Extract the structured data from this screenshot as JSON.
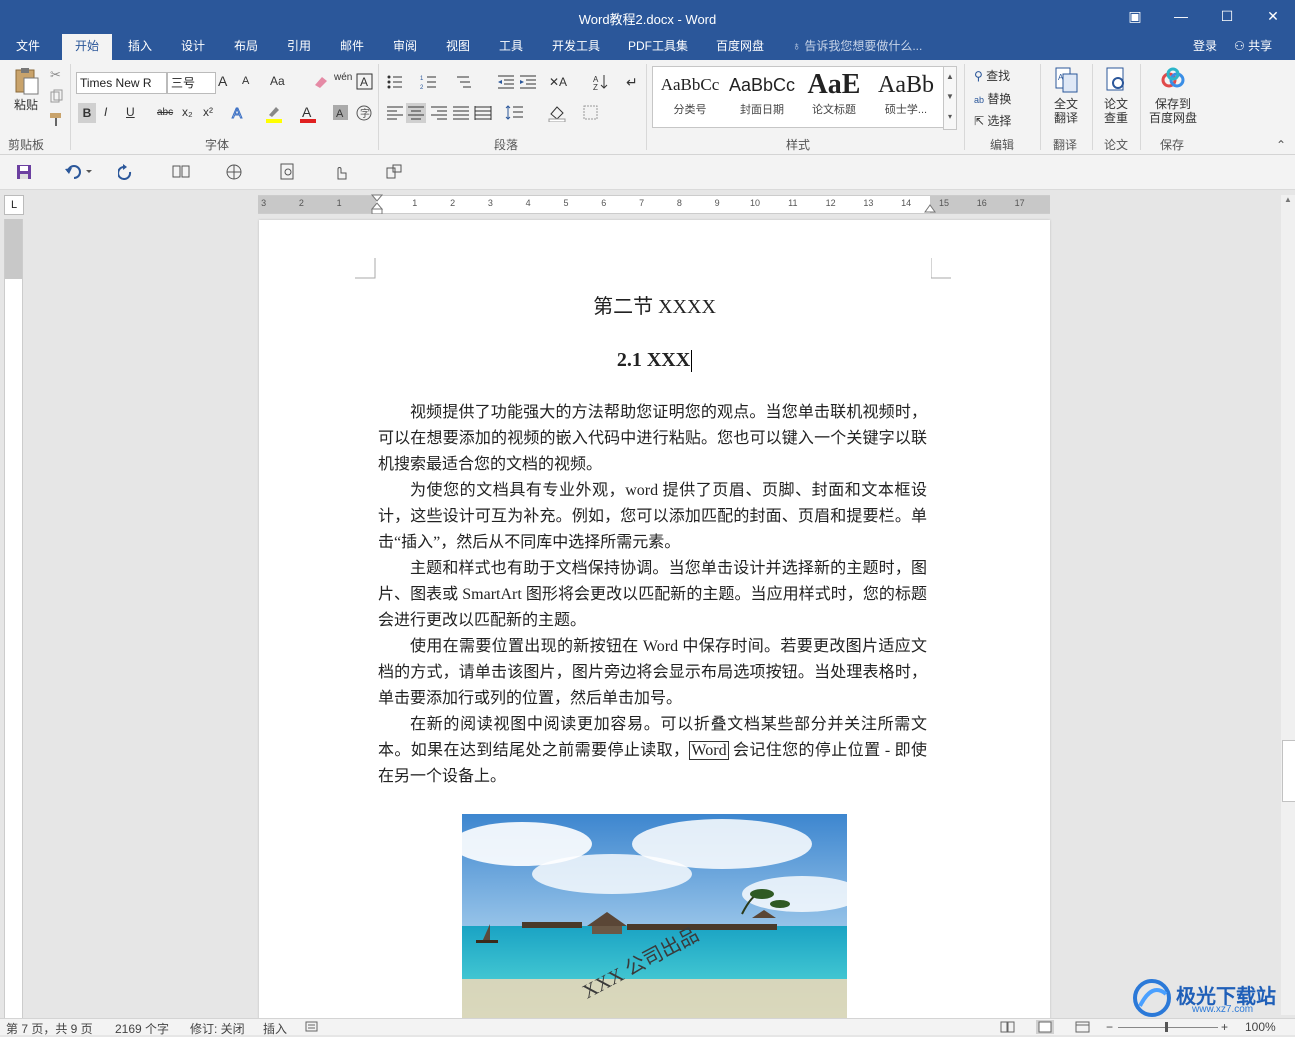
{
  "window": {
    "title": "Word教程2.docx - Word",
    "buttons": {
      "ribbon_options": "▣",
      "minimize": "—",
      "maximize": "☐",
      "close": "✕"
    }
  },
  "tabs": [
    "文件",
    "开始",
    "插入",
    "设计",
    "布局",
    "引用",
    "邮件",
    "审阅",
    "视图",
    "工具",
    "开发工具",
    "PDF工具集",
    "百度网盘"
  ],
  "active_tab": "开始",
  "tell_me": "告诉我您想要做什么...",
  "login": "登录",
  "share": "共享",
  "ribbon": {
    "clipboard": {
      "paste": "粘贴",
      "label": "剪贴板"
    },
    "font": {
      "name": "Times New R",
      "size": "三号",
      "bold": "B",
      "italic": "I",
      "underline": "U",
      "strike": "abc",
      "subscript": "x₂",
      "superscript": "x²",
      "grow": "A",
      "shrink": "A",
      "case": "Aa",
      "phonetic": "wén",
      "label": "字体"
    },
    "paragraph": {
      "label": "段落"
    },
    "styles": {
      "items": [
        {
          "sample": "AaBbCc",
          "name": "分类号"
        },
        {
          "sample": "AaBbCc",
          "name": "封面日期"
        },
        {
          "sample": "AaE",
          "name": "论文标题"
        },
        {
          "sample": "AaBb",
          "name": "硕士学..."
        }
      ],
      "label": "样式"
    },
    "editing": {
      "find": "查找",
      "replace": "替换",
      "select": "选择",
      "label": "编辑"
    },
    "translate": {
      "button": "全文\n翻译",
      "label": "翻译"
    },
    "paper": {
      "button": "论文\n查重",
      "label": "论文"
    },
    "save": {
      "button": "保存到\n百度网盘",
      "label": "保存"
    }
  },
  "document": {
    "heading1": "第二节  XXXX",
    "heading2": "2.1 XXX",
    "paragraphs": [
      "视频提供了功能强大的方法帮助您证明您的观点。当您单击联机视频时，可以在想要添加的视频的嵌入代码中进行粘贴。您也可以键入一个关键字以联机搜索最适合您的文档的视频。",
      "为使您的文档具有专业外观，word 提供了页眉、页脚、封面和文本框设计，这些设计可互为补充。例如，您可以添加匹配的封面、页眉和提要栏。单击“插入”，然后从不同库中选择所需元素。",
      "主题和样式也有助于文档保持协调。当您单击设计并选择新的主题时，图片、图表或 SmartArt 图形将会更改以匹配新的主题。当应用样式时，您的标题会进行更改以匹配新的主题。",
      "使用在需要位置出现的新按钮在 Word 中保存时间。若要更改图片适应文档的方式，请单击该图片，图片旁边将会显示布局选项按钮。当处理表格时，单击要添加行或列的位置，然后单击加号。"
    ],
    "last_paragraph": {
      "before": "在新的阅读视图中阅读更加容易。可以折叠文档某些部分并关注所需文本。如果在达到结尾处之前需要停止读取，",
      "boxed": "Word",
      "after": " 会记住您的停止位置 - 即使在另一个设备上。"
    },
    "watermark": "XXX 公司出品"
  },
  "ruler": {
    "h_ticks": [
      "3",
      "2",
      "1",
      "1",
      "2",
      "3",
      "4",
      "5",
      "6",
      "7",
      "8",
      "9",
      "10",
      "11",
      "12",
      "13",
      "14",
      "15",
      "16",
      "17"
    ],
    "corner": "L"
  },
  "status": {
    "page": "第 7 页，共 9 页",
    "words": "2169 个字",
    "track": "修订: 关闭",
    "mode": "插入",
    "zoom": "100%"
  },
  "brand_watermark": "极光下载站",
  "brand_url": "www.xz7.com"
}
